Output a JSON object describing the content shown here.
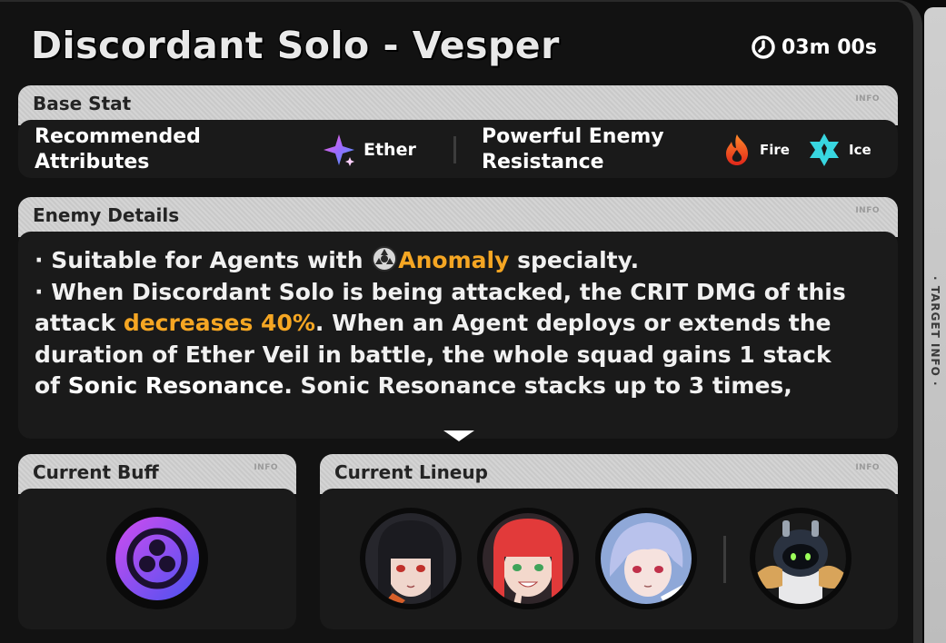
{
  "header": {
    "title": "Discordant Solo - Vesper",
    "timer": "03m 00s",
    "side_label": "· TARGET INFO ·"
  },
  "base_stat": {
    "title": "Base Stat",
    "info": "INFO",
    "recommended_label": "Recommended Attributes",
    "recommended": [
      {
        "name": "Ether",
        "icon": "ether-icon",
        "color": "#b06cff"
      }
    ],
    "resistance_label": "Powerful Enemy Resistance",
    "resistances": [
      {
        "name": "Fire",
        "icon": "fire-icon",
        "color": "#ff4a1f"
      },
      {
        "name": "Ice",
        "icon": "ice-icon",
        "color": "#3ee0e8"
      }
    ]
  },
  "enemy_details": {
    "title": "Enemy Details",
    "info": "INFO",
    "line1_prefix": "· Suitable for Agents with",
    "line1_highlight": "Anomaly",
    "line1_suffix": "specialty.",
    "line2_a": "· When Discordant Solo is being attacked, the CRIT DMG of this attack",
    "line2_highlight": "decreases 40%",
    "line2_b": ". When an Agent deploys or extends the duration of Ether Veil in battle, the whole squad gains 1 stack of",
    "line2_white": "Sonic Resonance",
    "line2_c": ". Sonic Resonance stacks up to 3 times,"
  },
  "current_buff": {
    "title": "Current Buff",
    "info": "INFO",
    "icon": "buff-icon"
  },
  "current_lineup": {
    "title": "Current Lineup",
    "info": "INFO",
    "agents": [
      "agent-portrait-black-hair",
      "agent-portrait-red-hair",
      "agent-portrait-silver-hair"
    ],
    "bangboo": "bangboo-portrait"
  },
  "colors": {
    "highlight": "#f5a623",
    "panel_head": "#d4d4d4",
    "panel_body": "#1a1a1a"
  }
}
